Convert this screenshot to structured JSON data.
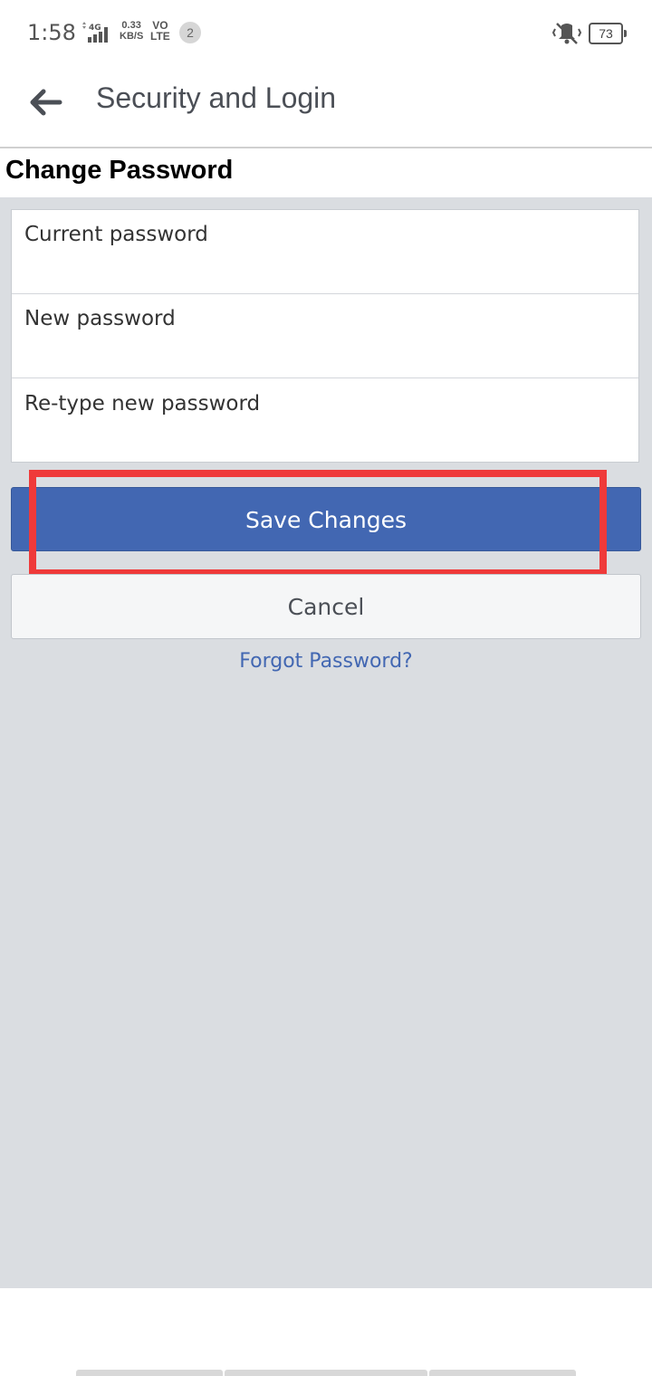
{
  "status_bar": {
    "time": "1:58",
    "network_type": "4G",
    "speed_value": "0.33",
    "speed_unit": "KB/S",
    "volte_top": "VO",
    "volte_bottom": "LTE",
    "notification_count": "2",
    "battery_level": "73",
    "icons": [
      "signal-icon",
      "mute-vibrate-icon",
      "battery-icon"
    ]
  },
  "app_bar": {
    "title": "Security and Login",
    "back_icon": "arrow-left-icon"
  },
  "section": {
    "title": "Change Password"
  },
  "form": {
    "fields": [
      {
        "placeholder": "Current password",
        "value": ""
      },
      {
        "placeholder": "New password",
        "value": ""
      },
      {
        "placeholder": "Re-type new password",
        "value": ""
      }
    ]
  },
  "actions": {
    "save_label": "Save Changes",
    "cancel_label": "Cancel",
    "forgot_label": "Forgot Password?"
  },
  "colors": {
    "primary": "#4267b2",
    "highlight": "#ef3a3a",
    "background": "#dadde1"
  }
}
